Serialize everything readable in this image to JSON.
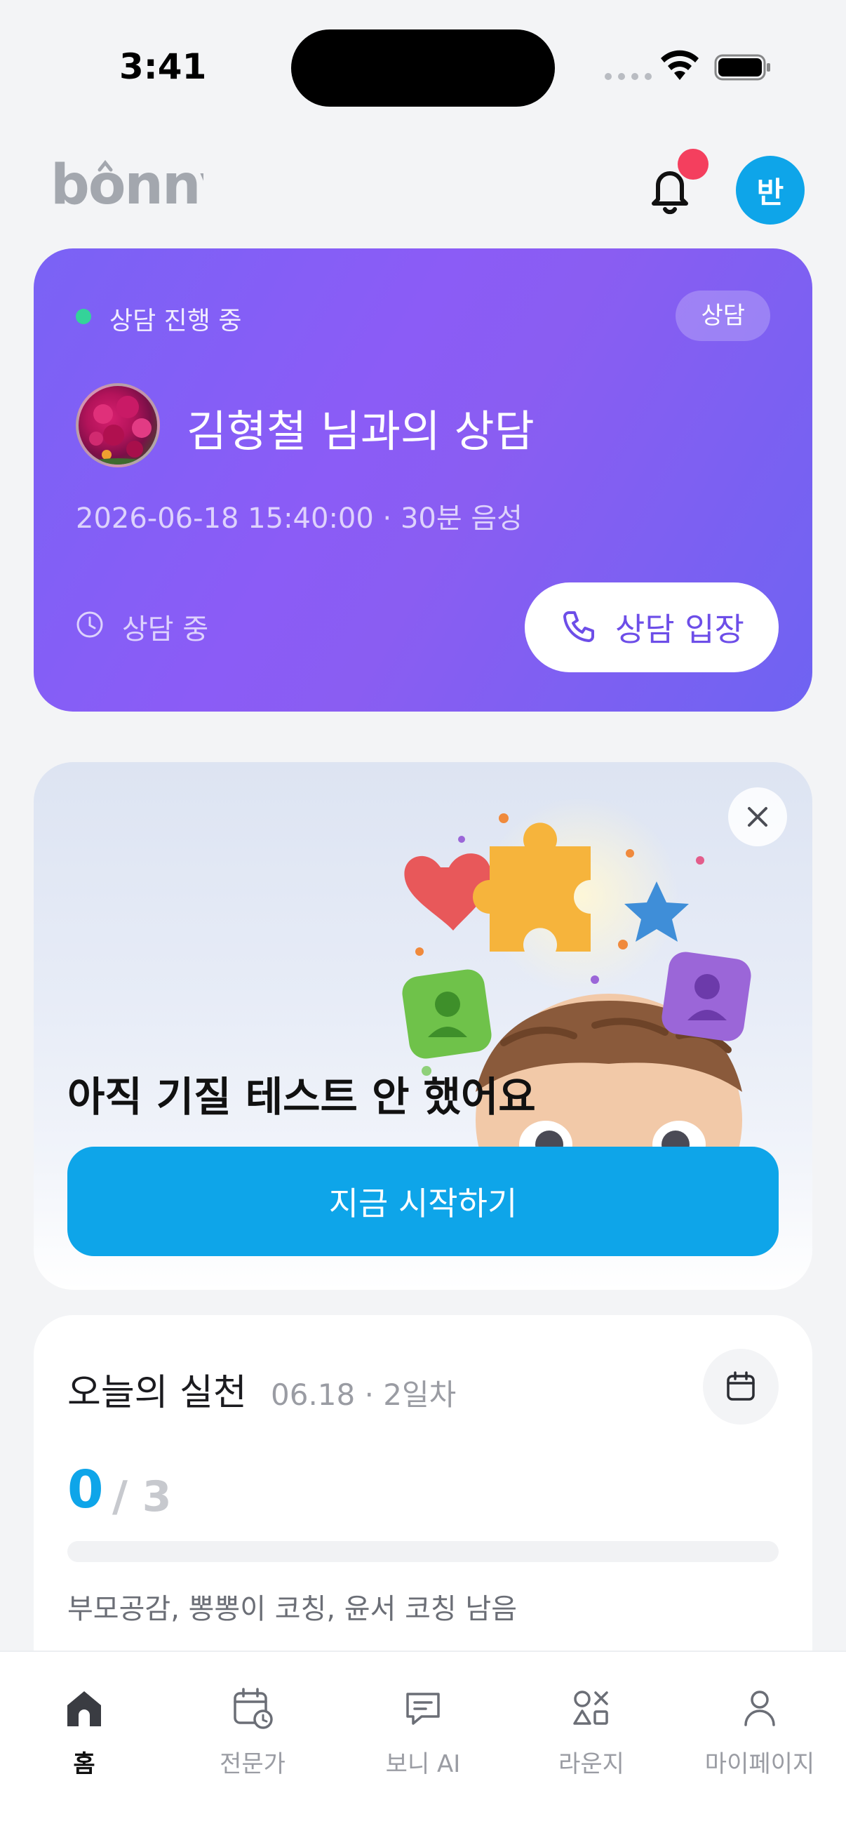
{
  "status_bar": {
    "time": "3:41"
  },
  "header": {
    "logo_text": "bonny",
    "avatar_initial": "반"
  },
  "consult_card": {
    "live_label": "상담 진행 중",
    "type_badge": "상담",
    "title": "김형철 님과의 상담",
    "session_info": "2026-06-18 15:40:00 · 30분 음성",
    "status_text": "상담 중",
    "enter_label": "상담 입장"
  },
  "promo": {
    "title": "아직 기질 테스트 안 했어요",
    "start_label": "지금 시작하기"
  },
  "practice": {
    "title": "오늘의 실천",
    "meta": "06.18 · 2일차",
    "done": "0",
    "total": "/ 3",
    "progress_fraction": 0,
    "remaining_text": "부모공감, 뽕뽕이 코칭, 윤서 코칭 남음"
  },
  "nav": {
    "items": [
      {
        "label": "홈",
        "icon": "home-icon",
        "active": true
      },
      {
        "label": "전문가",
        "icon": "calendar-clock-icon",
        "active": false
      },
      {
        "label": "보니 AI",
        "icon": "chat-icon",
        "active": false
      },
      {
        "label": "라운지",
        "icon": "shapes-icon",
        "active": false
      },
      {
        "label": "마이페이지",
        "icon": "person-icon",
        "active": false
      }
    ]
  },
  "colors": {
    "accent": "#0ea5e9",
    "card_gradient_start": "#7a62f5",
    "card_gradient_end": "#6f63f2",
    "live_dot": "#34d399",
    "notification_dot": "#f43f5e"
  }
}
